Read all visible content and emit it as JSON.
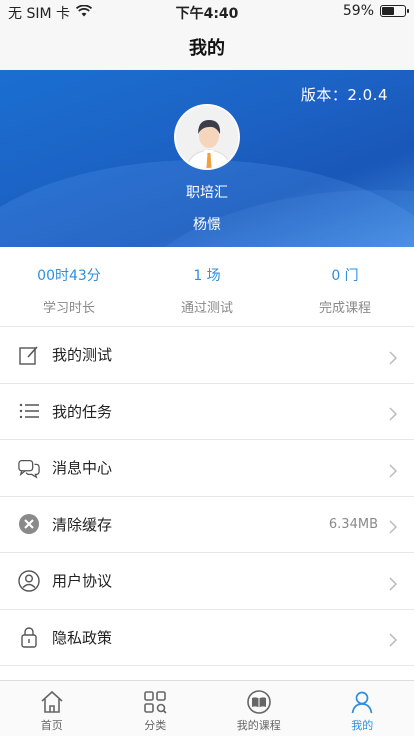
{
  "status_bar": {
    "carrier": "无 SIM 卡",
    "time": "下午4:40",
    "battery_percent": "59%",
    "battery_level": 0.59
  },
  "nav": {
    "title": "我的"
  },
  "profile": {
    "version_text": "版本：2.0.4",
    "org_name": "职培汇",
    "user_name": "杨憬"
  },
  "stats": [
    {
      "value": "00时43分",
      "label": "学习时长"
    },
    {
      "value": "1 场",
      "label": "通过测试"
    },
    {
      "value": "0 门",
      "label": "完成课程"
    }
  ],
  "menu": [
    {
      "label": "我的测试",
      "icon": "edit-icon",
      "extra": ""
    },
    {
      "label": "我的任务",
      "icon": "list-icon",
      "extra": ""
    },
    {
      "label": "消息中心",
      "icon": "chat-icon",
      "extra": ""
    },
    {
      "label": "清除缓存",
      "icon": "clear-cache-icon",
      "extra": "6.34MB"
    },
    {
      "label": "用户协议",
      "icon": "user-agreement-icon",
      "extra": ""
    },
    {
      "label": "隐私政策",
      "icon": "lock-icon",
      "extra": ""
    }
  ],
  "tabs": [
    {
      "label": "首页",
      "icon": "home-icon",
      "active": false
    },
    {
      "label": "分类",
      "icon": "category-icon",
      "active": false
    },
    {
      "label": "我的课程",
      "icon": "book-icon",
      "active": false
    },
    {
      "label": "我的",
      "icon": "profile-icon",
      "active": true
    }
  ],
  "colors": {
    "accent": "#2e8fe0",
    "hero_blue": "#1c63c6",
    "muted_text": "#8a8a8a"
  }
}
